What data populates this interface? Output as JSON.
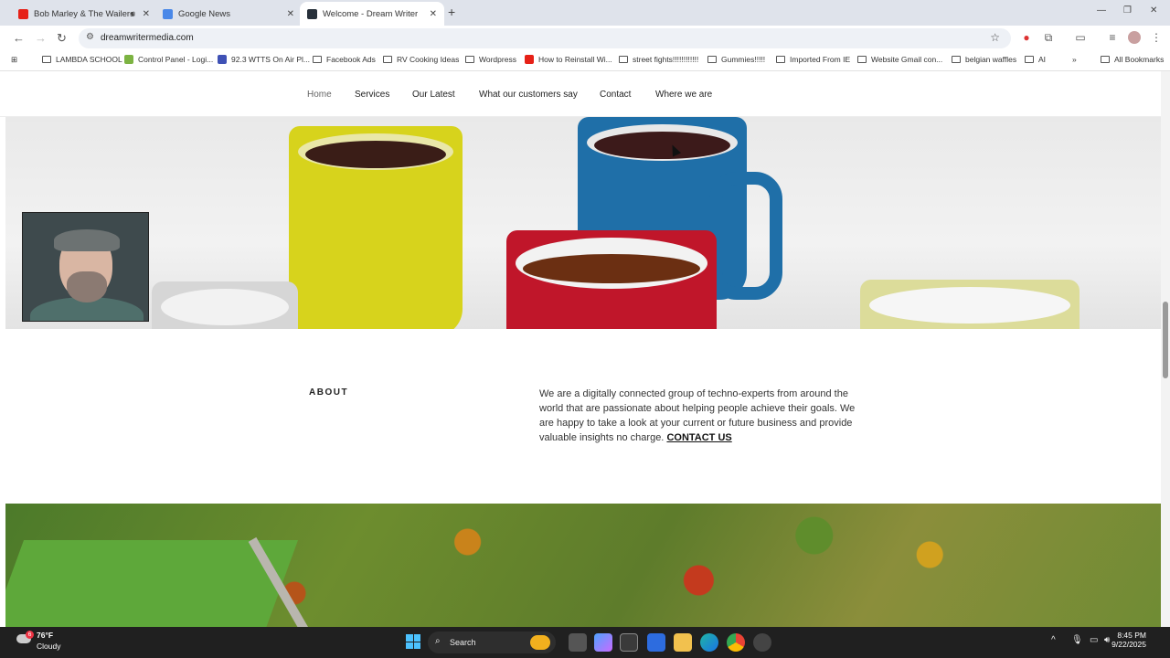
{
  "browser": {
    "tabs": [
      {
        "label": "Bob Marley & The Wailers",
        "active": false
      },
      {
        "label": "Google News",
        "active": false
      },
      {
        "label": "Welcome - Dream Writer",
        "active": true
      }
    ],
    "url": "dreamwritermedia.com",
    "bookmarks": [
      "LAMBDA SCHOOL",
      "Control Panel - Logi...",
      "92.3 WTTS On Air Pl...",
      "Facebook Ads",
      "RV Cooking Ideas",
      "Wordpress",
      "How to Reinstall Wi...",
      "street fights!!!!!!!!!!!!",
      "Gummies!!!!!",
      "Imported From IE",
      "Website Gmail con...",
      "belgian waffles",
      "AI"
    ],
    "all_bookmarks": "All Bookmarks"
  },
  "site": {
    "nav": [
      "Home",
      "Services",
      "Our Latest",
      "What our customers say",
      "Contact",
      "Where we are"
    ],
    "about_title": "ABOUT",
    "about_text": "We are a digitally connected group of techno-experts  from around the world that are passionate about helping people achieve their goals. We are happy to take a look at your current or future business and provide valuable insights no charge.",
    "contact_link": "CONTACT US"
  },
  "taskbar": {
    "temp": "76°F",
    "condition": "Cloudy",
    "weather_badge": "6",
    "search": "Search",
    "time": "8:45 PM",
    "date": "9/22/2025"
  }
}
